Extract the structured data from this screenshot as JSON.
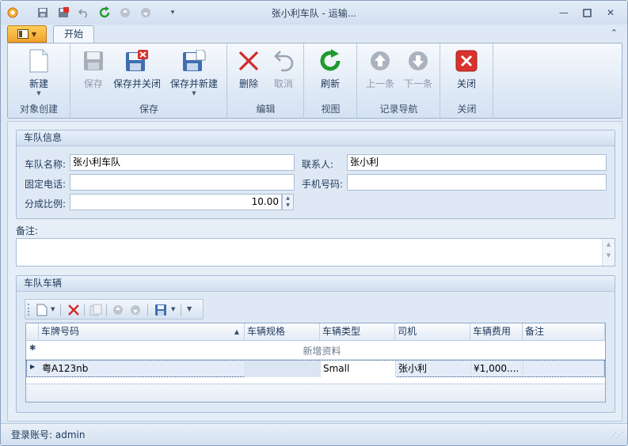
{
  "window": {
    "title": "张小利车队 - 运输..."
  },
  "tabs": {
    "start": "开始"
  },
  "ribbon": {
    "new": "新建",
    "save": "保存",
    "save_close": "保存并关闭",
    "save_new": "保存并新建",
    "delete": "删除",
    "cancel": "取消",
    "refresh": "刷新",
    "prev": "上一条",
    "next": "下一条",
    "close": "关闭",
    "group_create": "对象创建",
    "group_save": "保存",
    "group_edit": "编辑",
    "group_view": "视图",
    "group_nav": "记录导航",
    "group_close": "关闭"
  },
  "fleet_info": {
    "header": "车队信息",
    "name_label": "车队名称:",
    "name_value": "张小利车队",
    "contact_label": "联系人:",
    "contact_value": "张小利",
    "phone_label": "固定电话:",
    "phone_value": "",
    "mobile_label": "手机号码:",
    "mobile_value": "",
    "ratio_label": "分成比例:",
    "ratio_value": "10.00"
  },
  "remarks": {
    "label": "备注:",
    "value": ""
  },
  "vehicles": {
    "header": "车队车辆",
    "columns": [
      "车牌号码",
      "车辆规格",
      "车辆类型",
      "司机",
      "车辆费用",
      "备注"
    ],
    "new_row_text": "新增资料",
    "rows": [
      {
        "plate": "粤A123nb",
        "spec": "",
        "type": "Small",
        "driver": "张小利",
        "cost": "¥1,000....",
        "note": ""
      }
    ]
  },
  "status": {
    "text": "登录账号: admin"
  }
}
